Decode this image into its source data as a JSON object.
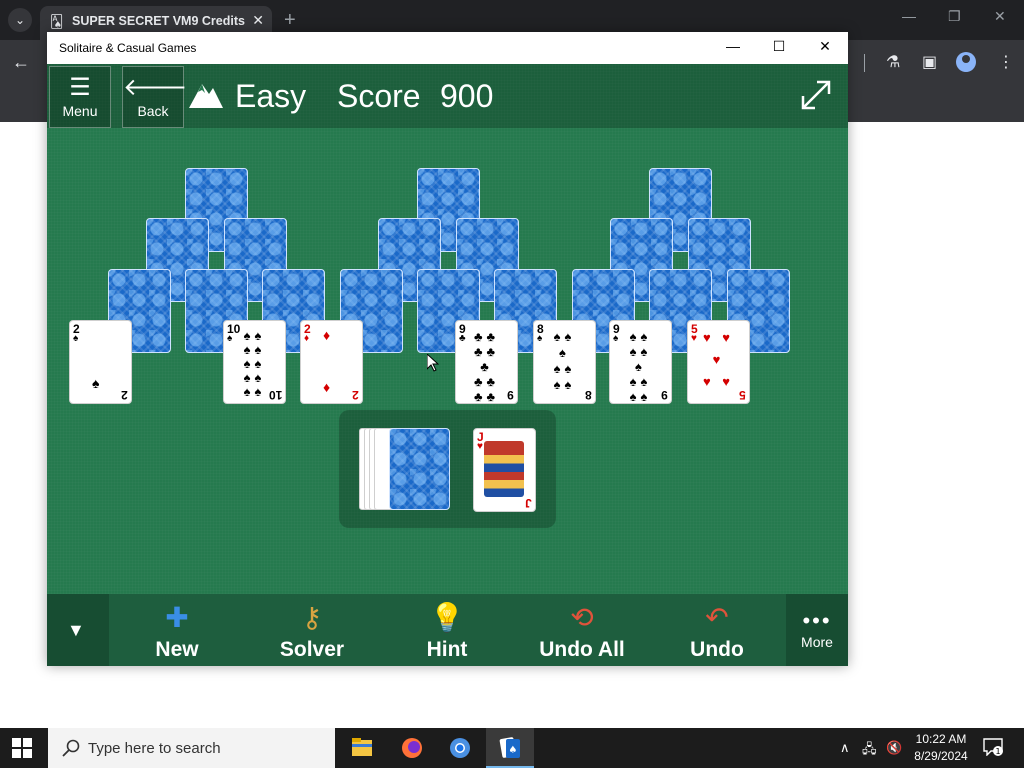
{
  "browser": {
    "tab_title": "SUPER SECRET VM9 Credits",
    "tab_close": "✕",
    "new_tab": "+"
  },
  "app": {
    "window_title": "Solitaire & Casual Games",
    "header": {
      "menu_label": "Menu",
      "back_label": "Back",
      "difficulty": "Easy",
      "score_label": "Score",
      "score_value": "900"
    },
    "toolbar": {
      "new_label": "New",
      "solver_label": "Solver",
      "hint_label": "Hint",
      "undo_all_label": "Undo All",
      "undo_label": "Undo",
      "more_label": "More"
    },
    "bottom_row": [
      {
        "rank": "2",
        "suit": "♠",
        "color": "black"
      },
      {
        "rank": "10",
        "suit": "♠",
        "color": "black"
      },
      {
        "rank": "2",
        "suit": "♦",
        "color": "red"
      },
      {
        "rank": "9",
        "suit": "♣",
        "color": "black"
      },
      {
        "rank": "8",
        "suit": "♠",
        "color": "black"
      },
      {
        "rank": "9",
        "suit": "♠",
        "color": "black"
      },
      {
        "rank": "5",
        "suit": "♥",
        "color": "red"
      }
    ],
    "waste_card": {
      "rank": "J",
      "suit": "♥",
      "color": "red"
    }
  },
  "taskbar": {
    "search_placeholder": "Type here to search",
    "time": "10:22 AM",
    "date": "8/29/2024",
    "notification_count": "1"
  },
  "colors": {
    "felt": "#257a4e",
    "card_back": "#1a69c9",
    "red_suit": "#d40000",
    "new_icon": "#3a8ee6",
    "undo_icon": "#e0533b"
  }
}
